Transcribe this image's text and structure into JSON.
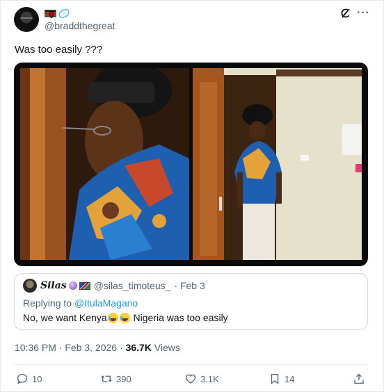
{
  "author": {
    "handle": "@braddthegreat",
    "badges": [
      "kenya-flag",
      "rugby-ball"
    ]
  },
  "tweet": {
    "text": "Was too easily ???"
  },
  "quote": {
    "name": "Silas",
    "handle": "@silas_timoteus_",
    "date": "· Feb 3",
    "reply_prefix": "Replying to",
    "reply_to": "@ItulaMagano",
    "text_before": "No, we want Kenya",
    "text_after": " Nigeria was too easily",
    "emojis": [
      "crying-laughing-face",
      "crying-laughing-face"
    ]
  },
  "meta": {
    "time": "10:36 PM · Feb 3, 2026 · ",
    "views_count": "36.7K",
    "views_label": " Views"
  },
  "actions": {
    "replies": "10",
    "reposts": "390",
    "likes": "3.1K",
    "bookmarks": "14"
  },
  "colors": {
    "accent": "#1d9bf0",
    "secondary_text": "#536471",
    "border": "#cfd9de"
  }
}
